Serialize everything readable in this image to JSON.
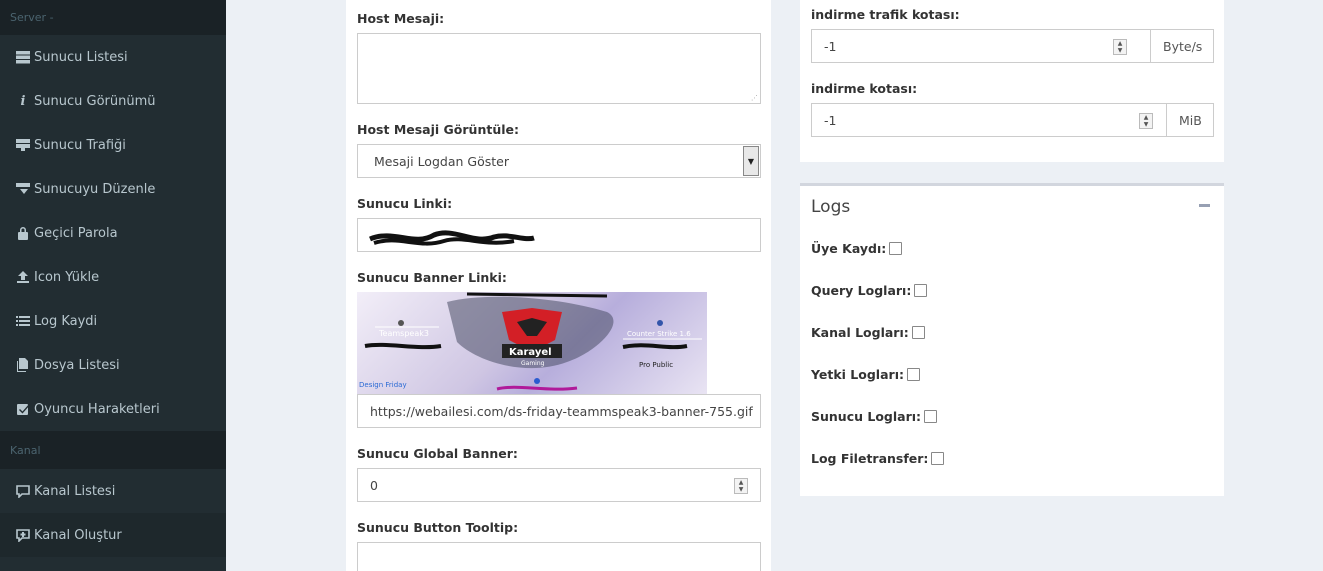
{
  "sidebar": {
    "section_server": "Server -",
    "items_server": [
      {
        "label": "Sunucu Listesi",
        "icon": "server-list-icon"
      },
      {
        "label": "Sunucu Görünümü",
        "icon": "info-icon"
      },
      {
        "label": "Sunucu Trafiği",
        "icon": "traffic-icon"
      },
      {
        "label": "Sunucuyu Düzenle",
        "icon": "edit-server-icon"
      },
      {
        "label": "Geçici Parola",
        "icon": "lock-icon"
      },
      {
        "label": "Icon Yükle",
        "icon": "upload-icon"
      },
      {
        "label": "Log Kaydi",
        "icon": "list-icon"
      },
      {
        "label": "Dosya Listesi",
        "icon": "files-icon"
      },
      {
        "label": "Oyuncu Haraketleri",
        "icon": "check-square-icon"
      }
    ],
    "section_channel": "Kanal",
    "items_channel": [
      {
        "label": "Kanal Listesi",
        "icon": "comment-icon"
      },
      {
        "label": "Kanal Oluştur",
        "icon": "comment-plus-icon"
      }
    ]
  },
  "form": {
    "host_message_label": "Host Mesaji:",
    "host_message_value": "",
    "host_message_display_label": "Host Mesaji Görüntüle:",
    "host_message_display_value": "Mesaji Logdan Göster",
    "server_link_label": "Sunucu Linki:",
    "server_banner_label": "Sunucu Banner Linki:",
    "server_banner_url": "https://webailesi.com/ds-friday-teammspeak3-banner-755.gif",
    "banner_image": {
      "left_text": "Teamspeak3",
      "center_logo_text": "Karayel",
      "center_logo_sub": "Gaming",
      "right_text": "Counter Strike 1.6",
      "right_sub": "Pro Public",
      "bottom_left": "Design Friday"
    },
    "global_banner_label": "Sunucu Global Banner:",
    "global_banner_value": "0",
    "button_tooltip_label": "Sunucu Button Tooltip:"
  },
  "quota": {
    "download_traffic_label": "indirme trafik kotası:",
    "download_traffic_value": "-1",
    "download_traffic_unit": "Byte/s",
    "download_quota_label": "indirme kotası:",
    "download_quota_value": "-1",
    "download_quota_unit": "MiB"
  },
  "logs": {
    "title": "Logs",
    "options": [
      {
        "label": "Üye Kaydı:",
        "checked": false
      },
      {
        "label": "Query Logları:",
        "checked": false
      },
      {
        "label": "Kanal Logları:",
        "checked": false
      },
      {
        "label": "Yetki Logları:",
        "checked": false
      },
      {
        "label": "Sunucu Logları:",
        "checked": false
      },
      {
        "label": "Log Filetransfer:",
        "checked": false
      }
    ]
  },
  "colors": {
    "sidebar_bg": "#222d32",
    "sidebar_header_bg": "#1a2226",
    "page_bg": "#ecf0f5"
  }
}
